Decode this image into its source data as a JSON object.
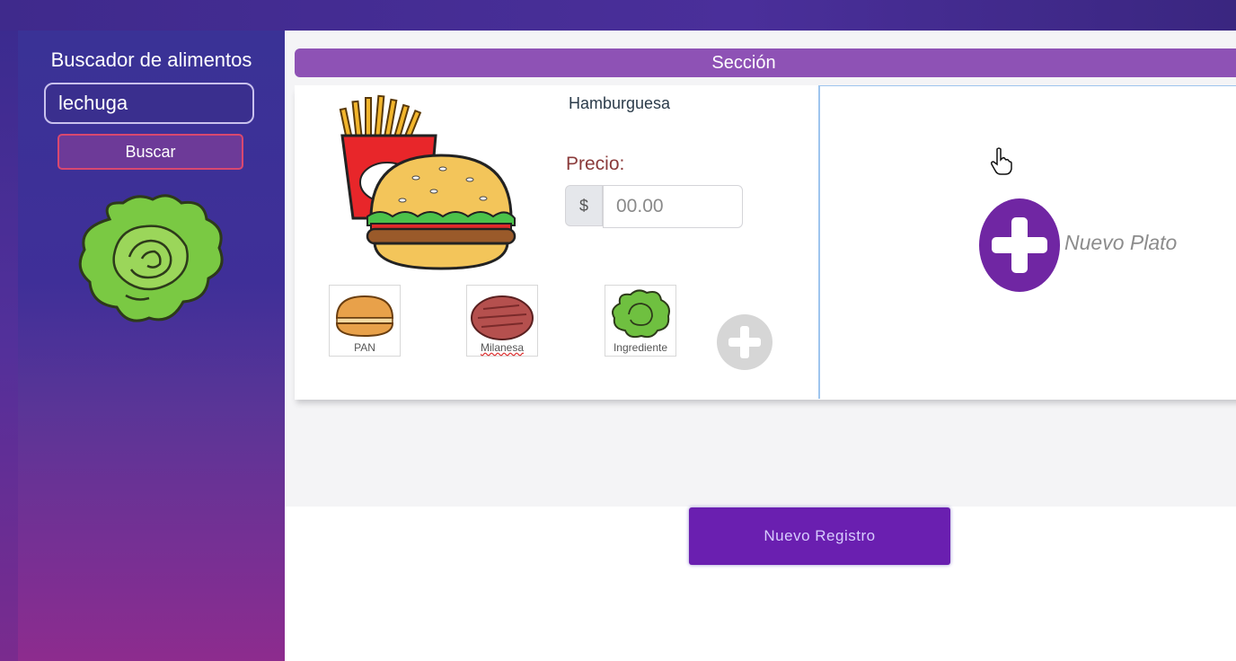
{
  "sidebar": {
    "title": "Buscador de alimentos",
    "search_value": "lechuga",
    "search_button": "Buscar",
    "result_icon": "lettuce-icon"
  },
  "section": {
    "title": "Sección"
  },
  "dish": {
    "name": "Hamburguesa",
    "image_icon": "burger-fries-icon",
    "price_label": "Precio:",
    "currency_symbol": "$",
    "price_placeholder": "00.00",
    "ingredients": [
      {
        "label": "PAN",
        "icon": "bun-icon"
      },
      {
        "label": "Milanesa",
        "icon": "patty-icon"
      },
      {
        "label": "Ingrediente",
        "icon": "lettuce-icon"
      }
    ],
    "add_ingredient_icon": "plus-circle-icon"
  },
  "new_dish": {
    "label": "Nuevo Plato",
    "icon": "plus-circle-icon"
  },
  "footer": {
    "new_register_button": "Nuevo Registro"
  },
  "colors": {
    "sidebar_top": "#3a3296",
    "sidebar_bottom": "#8d2c8e",
    "section_bar": "#8e52b5",
    "accent_purple": "#7026a3",
    "register_button": "#6a1fb0"
  }
}
